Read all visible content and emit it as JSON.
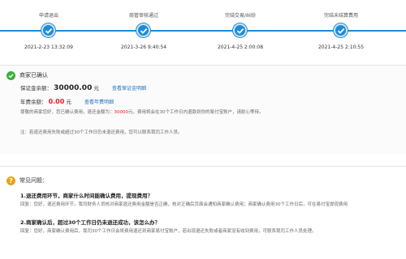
{
  "steps": [
    {
      "label": "申请退出",
      "time": "2021-2-23 13:32:09"
    },
    {
      "label": "商管审核通过",
      "time": "2021-3-26 9:40:54"
    },
    {
      "label": "完结交易/纠纷",
      "time": "2021-4-25 2:00:08"
    },
    {
      "label": "完结未结算费用",
      "time": "2021-4-25 2:10:55"
    }
  ],
  "confirm": {
    "title": "商家已确认",
    "deposit_label": "保证金余额：",
    "deposit_value": "30000.00",
    "deposit_unit": "元",
    "deposit_link": "查看保证金明细",
    "annual_label": "年费余额：",
    "annual_value": "0.00",
    "annual_unit": "元",
    "annual_link": "查看年费明细",
    "message_prefix": "尊敬的商家您好，您已确认费用，退还金额为：",
    "message_amount": "30000",
    "message_suffix": "元。费用将会在30个工作日内退款到你的易付宝账户，请耐心等待。",
    "notice": "注：若退还费用失败或超过30个工作日仍未退还费用，您可以联系我司工作人员。"
  },
  "faq": {
    "title": "常见问题：",
    "q1": "1.退还费用环节，商家什么时间能确认费用，提现费用？",
    "a1": "回复：您好，退还费用环节，我司财务人员核对商家退还费用金额是否正确，核对正确后页面会通知商家确认费用；商家确认费用30个工作日后，可在易付宝提现费用",
    "q2": "2.商家确认后，超过30个工作日仍未退还成功，该怎么办？",
    "a2": "回复：您好，商家确认费用后，我司30个工作日会将费用退还到商家易付宝账户，若出现退还失败或者商家没有收到费用，可联系我司工作人员处理。"
  },
  "colors": {
    "accent": "#1f8bd6",
    "ok": "#3cae3c",
    "warn": "#e8a317",
    "red": "#e02020"
  }
}
